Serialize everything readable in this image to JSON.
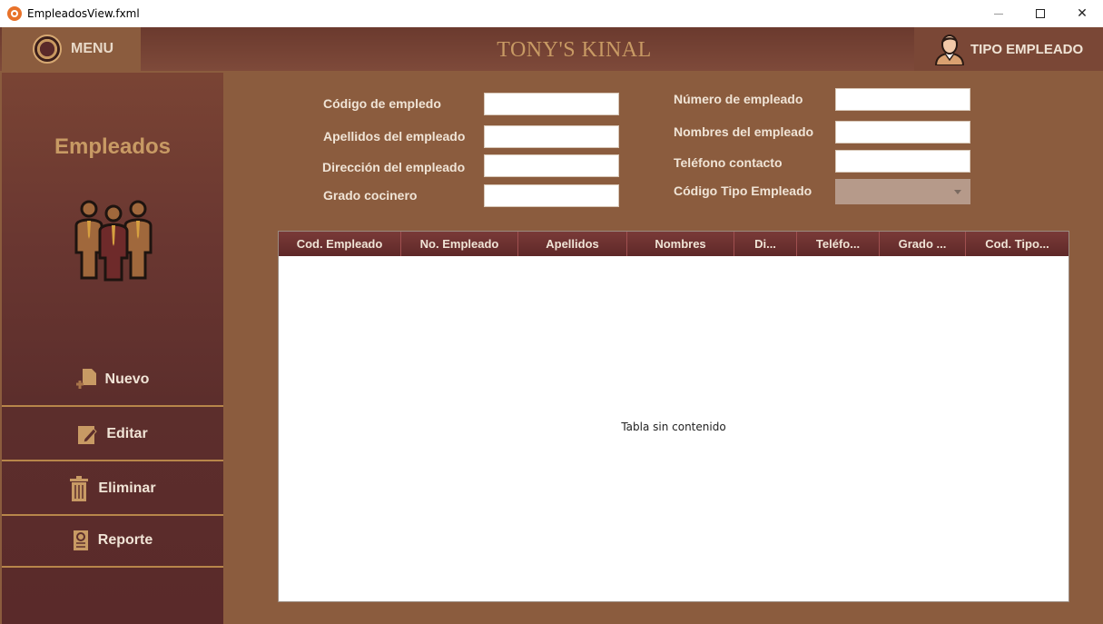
{
  "window": {
    "title": "EmpleadosView.fxml"
  },
  "header": {
    "menu_label": "MENU",
    "brand": "TONY'S KINAL",
    "tipo_label": "TIPO EMPLEADO"
  },
  "sidebar": {
    "title": "Empleados",
    "buttons": [
      {
        "label": "Nuevo",
        "icon": "new-file-icon"
      },
      {
        "label": "Editar",
        "icon": "edit-icon"
      },
      {
        "label": "Eliminar",
        "icon": "trash-icon"
      },
      {
        "label": "Reporte",
        "icon": "report-icon"
      }
    ]
  },
  "form": {
    "codigo_empleado": {
      "label": "Código de empledo",
      "value": ""
    },
    "apellidos": {
      "label": "Apellidos del empleado",
      "value": ""
    },
    "direccion": {
      "label": "Dirección del empleado",
      "value": ""
    },
    "grado": {
      "label": "Grado cocinero",
      "value": ""
    },
    "numero": {
      "label": "Número de empleado",
      "value": ""
    },
    "nombres": {
      "label": "Nombres del empleado",
      "value": ""
    },
    "telefono": {
      "label": "Teléfono contacto",
      "value": ""
    },
    "codigo_tipo": {
      "label": "Código Tipo Empleado",
      "value": ""
    }
  },
  "table": {
    "columns": [
      "Cod. Empleado",
      "No. Empleado",
      "Apellidos",
      "Nombres",
      "Di...",
      "Teléfo...",
      "Grado ...",
      "Cod. Tipo..."
    ],
    "rows": [],
    "empty_text": "Tabla sin contenido"
  },
  "colors": {
    "background": "#8B5C3E",
    "sidebar": "#5C2E2C",
    "accent": "#C89A64",
    "table_header": "#6A2E2E"
  }
}
